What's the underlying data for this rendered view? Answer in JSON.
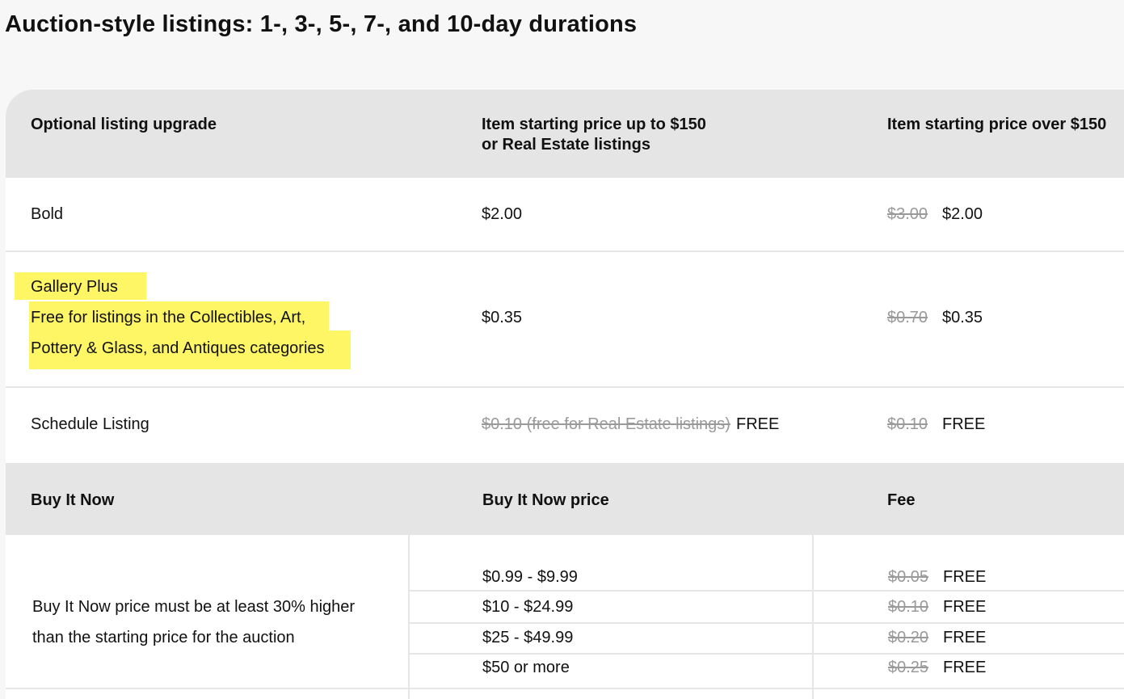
{
  "page": {
    "title": "Auction-style listings: 1-, 3-, 5-, 7-, and 10-day durations"
  },
  "upgrades_header": {
    "col1": "Optional listing upgrade",
    "col2_line1": "Item starting price up to $150",
    "col2_line2": "or Real Estate listings",
    "col3": "Item starting price over $150"
  },
  "upgrades": {
    "bold": {
      "name": "Bold",
      "low_price": "$2.00",
      "high_old": "$3.00",
      "high_new": "$2.00"
    },
    "gallery_plus": {
      "name": "Gallery Plus",
      "note_line1": "Free for listings in the Collectibles, Art,",
      "note_line2": "Pottery & Glass, and Antiques categories",
      "low_price": "$0.35",
      "high_old": "$0.70",
      "high_new": "$0.35"
    },
    "schedule": {
      "name": "Schedule Listing",
      "low_old": "$0.10 (free for Real Estate listings)",
      "low_new": "FREE",
      "high_old": "$0.10",
      "high_new": "FREE"
    }
  },
  "bin_header": {
    "col1": "Buy It Now",
    "col2": "Buy It Now price",
    "col3": "Fee"
  },
  "bin": {
    "note_line1": "Buy It Now price must be at least 30% higher",
    "note_line2": "than the starting price for the auction",
    "rows": [
      {
        "range": "$0.99 - $9.99",
        "old_fee": "$0.05",
        "new_fee": "FREE"
      },
      {
        "range": "$10 - $24.99",
        "old_fee": "$0.10",
        "new_fee": "FREE"
      },
      {
        "range": "$25 - $49.99",
        "old_fee": "$0.20",
        "new_fee": "FREE"
      },
      {
        "range": "$50 or more",
        "old_fee": "$0.25",
        "new_fee": "FREE"
      }
    ]
  },
  "colors": {
    "highlight": "#fff666",
    "header_bg": "#e5e5e5",
    "strike_text": "#9a9a9a"
  }
}
